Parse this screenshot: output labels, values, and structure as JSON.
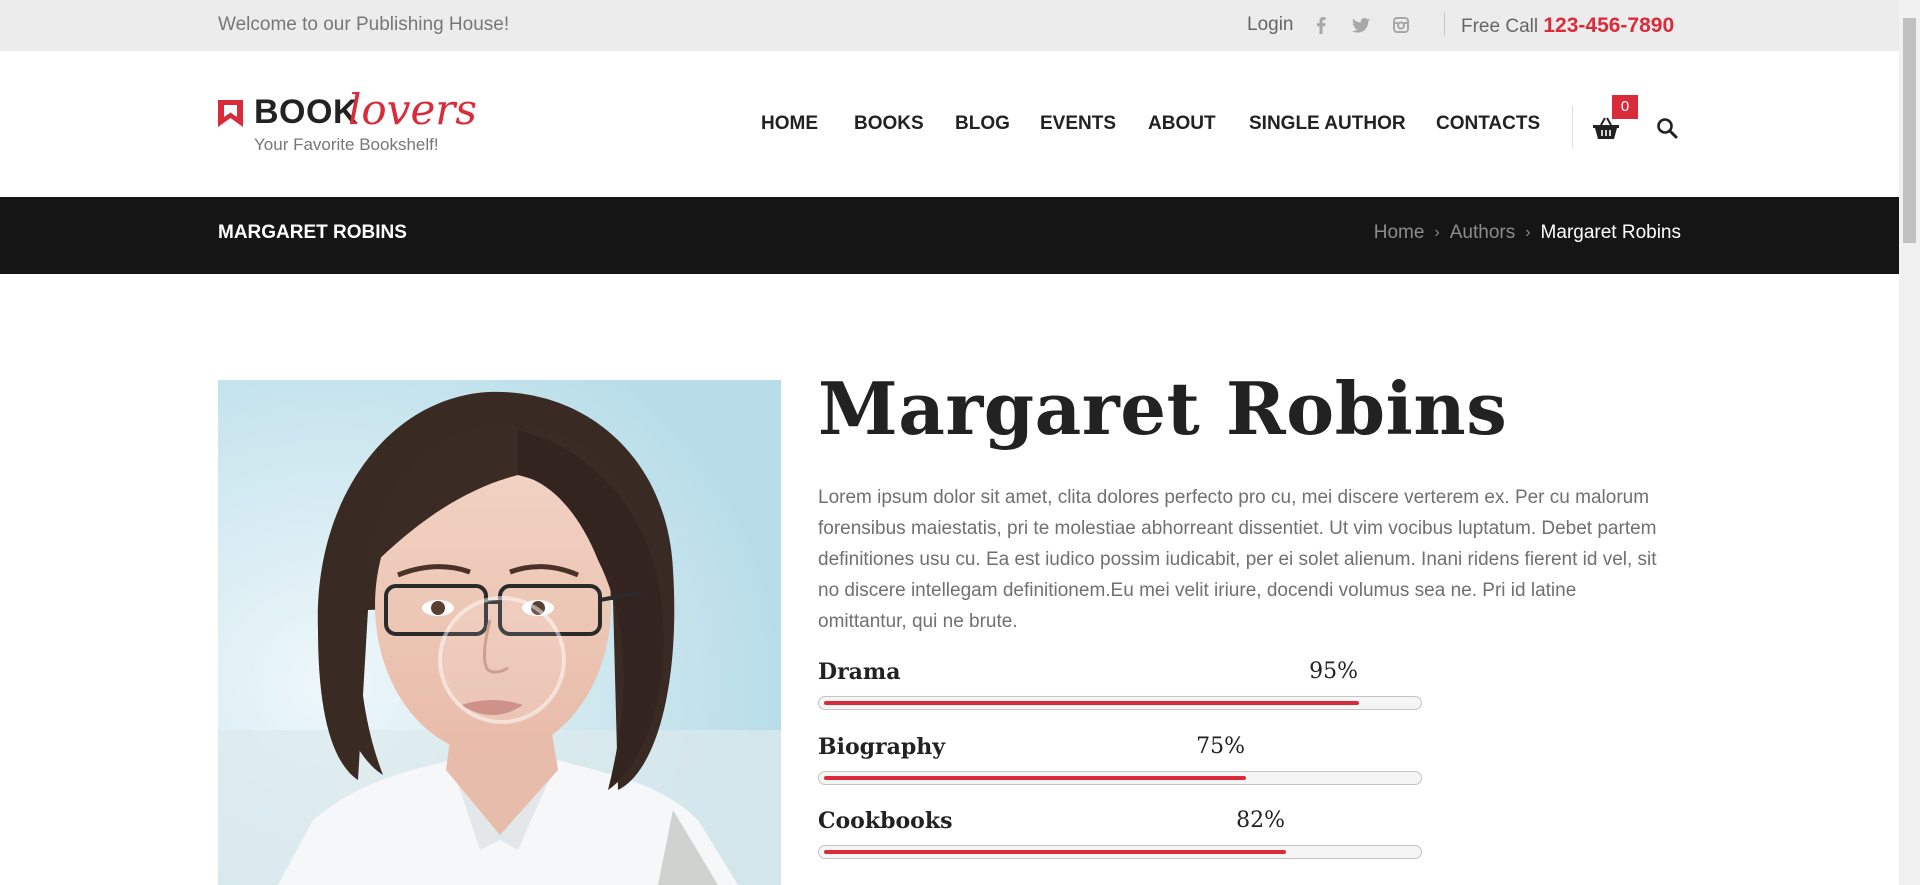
{
  "topbar": {
    "welcome": "Welcome to our Publishing House!",
    "login": "Login",
    "social_icons": [
      "facebook-icon",
      "twitter-icon",
      "instagram-icon"
    ],
    "free_call_label": "Free Call",
    "phone": "123-456-7890"
  },
  "logo": {
    "book": "BOOK",
    "lovers": "lovers",
    "tagline": "Your Favorite Bookshelf!"
  },
  "nav": {
    "items": [
      "HOME",
      "BOOKS",
      "BLOG",
      "EVENTS",
      "ABOUT",
      "SINGLE AUTHOR",
      "CONTACTS"
    ],
    "cart_count": "0"
  },
  "page_title": "MARGARET ROBINS",
  "breadcrumb": {
    "home": "Home",
    "authors": "Authors",
    "current": "Margaret Robins"
  },
  "author": {
    "name": "Margaret Robins",
    "bio": "Lorem ipsum dolor sit amet, clita dolores perfecto pro cu, mei discere verterem ex. Per cu malorum forensibus maiestatis, pri te molestiae abhorreant dissentiet. Ut vim vocibus luptatum. Debet partem definitiones usu cu. Ea est iudico possim iudicabit, per ei solet alienum. Inani ridens fierent id vel, sit no discere intellegam definitionem.Eu mei velit iriure, docendi volumus sea ne. Pri id latine omittantur, qui ne brute."
  },
  "skills": [
    {
      "name": "Drama",
      "label": "95%",
      "value": 95
    },
    {
      "name": "Biography",
      "label": "75%",
      "value": 75
    },
    {
      "name": "Cookbooks",
      "label": "82%",
      "value": 82
    }
  ],
  "colors": {
    "accent": "#d92b3a",
    "title_bar": "#151515",
    "top_bar": "#ececec"
  }
}
